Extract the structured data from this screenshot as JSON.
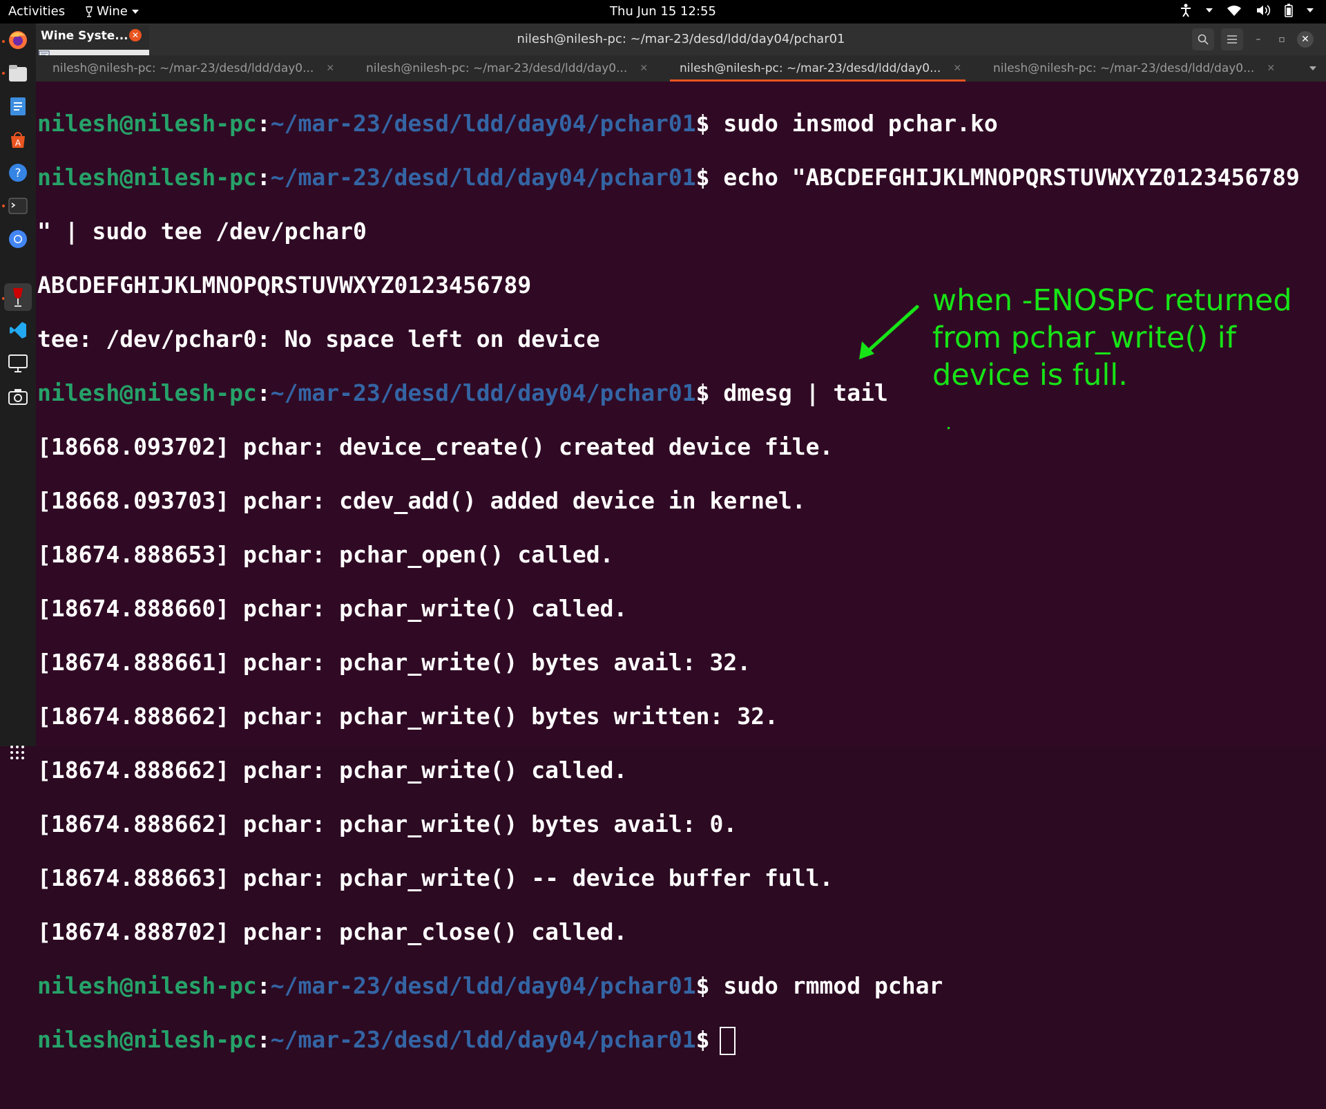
{
  "topbar": {
    "activities": "Activities",
    "app_menu": "Wine",
    "clock": "Thu Jun 15  12:55",
    "tray_icons": [
      "accessibility-icon",
      "wifi-icon",
      "volume-icon",
      "battery-icon"
    ]
  },
  "dock": {
    "items": [
      "firefox-icon",
      "files-icon",
      "text-editor-icon",
      "software-center-icon",
      "help-icon",
      "terminal-icon",
      "chromium-icon",
      "wine-icon",
      "vscode-icon",
      "remote-desktop-icon",
      "screenshot-icon"
    ],
    "apps_grid": "show-applications-icon"
  },
  "wine_popup": {
    "title": "Wine Syste..."
  },
  "window": {
    "title": "nilesh@nilesh-pc: ~/mar-23/desd/ldd/day04/pchar01"
  },
  "tabs": [
    {
      "label": "nilesh@nilesh-pc: ~/mar-23/desd/ldd/day0...",
      "active": false
    },
    {
      "label": "nilesh@nilesh-pc: ~/mar-23/desd/ldd/day0...",
      "active": false
    },
    {
      "label": "nilesh@nilesh-pc: ~/mar-23/desd/ldd/day0...",
      "active": true
    },
    {
      "label": "nilesh@nilesh-pc: ~/mar-23/desd/ldd/day0...",
      "active": false
    }
  ],
  "terminal": {
    "user_host": "nilesh@nilesh-pc",
    "path": "~/mar-23/desd/ldd/day04/pchar01",
    "cmd1": "sudo insmod pchar.ko",
    "cmd2a": "echo \"ABCDEFGHIJKLMNOPQRSTUVWXYZ0123456789",
    "cmd2b": "\" | sudo tee /dev/pchar0",
    "out1": "ABCDEFGHIJKLMNOPQRSTUVWXYZ0123456789",
    "out2": "tee: /dev/pchar0: No space left on device",
    "cmd3": "dmesg | tail",
    "dmesg": [
      "[18668.093702] pchar: device_create() created device file.",
      "[18668.093703] pchar: cdev_add() added device in kernel.",
      "[18674.888653] pchar: pchar_open() called.",
      "[18674.888660] pchar: pchar_write() called.",
      "[18674.888661] pchar: pchar_write() bytes avail: 32.",
      "[18674.888662] pchar: pchar_write() bytes written: 32.",
      "[18674.888662] pchar: pchar_write() called.",
      "[18674.888662] pchar: pchar_write() bytes avail: 0.",
      "[18674.888663] pchar: pchar_write() -- device buffer full.",
      "[18674.888702] pchar: pchar_close() called."
    ],
    "cmd4": "sudo rmmod pchar"
  },
  "annotation": {
    "lines": [
      "when -ENOSPC returned",
      "from pchar_write() if",
      "device is full."
    ],
    "color": "#17e417"
  }
}
